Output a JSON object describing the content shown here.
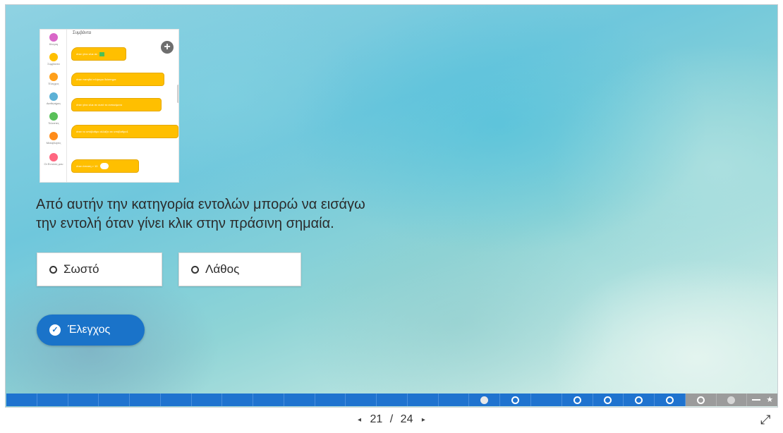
{
  "thumbnail": {
    "title": "Συμβάντα",
    "categories": [
      {
        "label": "Κίνηση",
        "color": "#d966c8"
      },
      {
        "label": "Συμβάντα",
        "color": "#ffbf00"
      },
      {
        "label": "Έλεγχος",
        "color": "#ff9f1a"
      },
      {
        "label": "Αισθητήρες",
        "color": "#5cb1d6"
      },
      {
        "label": "Τελεστές",
        "color": "#59c059"
      },
      {
        "label": "Μεταβλητές",
        "color": "#ff8c1a"
      },
      {
        "label": "Οι Εντολές μου",
        "color": "#ff6680"
      }
    ],
    "blocks": [
      "όταν γίνει κλικ σε",
      "όταν πατηθεί πλήκτρο  διάστημα",
      "όταν γίνει κλικ σε αυτό το αντικείμενο",
      "όταν το υπόβαθρο αλλάξει σε  υπόβαθρο1",
      "όταν  ένταση  >  10"
    ]
  },
  "question": {
    "line1": "Από αυτήν την κατηγορία εντολών μπορώ να εισάγω",
    "line2": "την εντολή όταν γίνει κλικ στην πράσινη σημαία."
  },
  "options": {
    "true_label": "Σωστό",
    "false_label": "Λάθος"
  },
  "check_button": {
    "label": "Έλεγχος",
    "icon": "check-circle-icon"
  },
  "progress": {
    "total_slides": 24,
    "current_slide": 21
  },
  "navigation": {
    "prev_icon": "◂",
    "current": "21",
    "separator": "/",
    "total": "24",
    "next_icon": "▸",
    "fullscreen_icon": "⤢"
  },
  "colors": {
    "accent": "#1a73c9",
    "progress_done": "#1f73cf",
    "progress_remaining": "#9b9b9b",
    "block_yellow": "#ffbf00"
  }
}
